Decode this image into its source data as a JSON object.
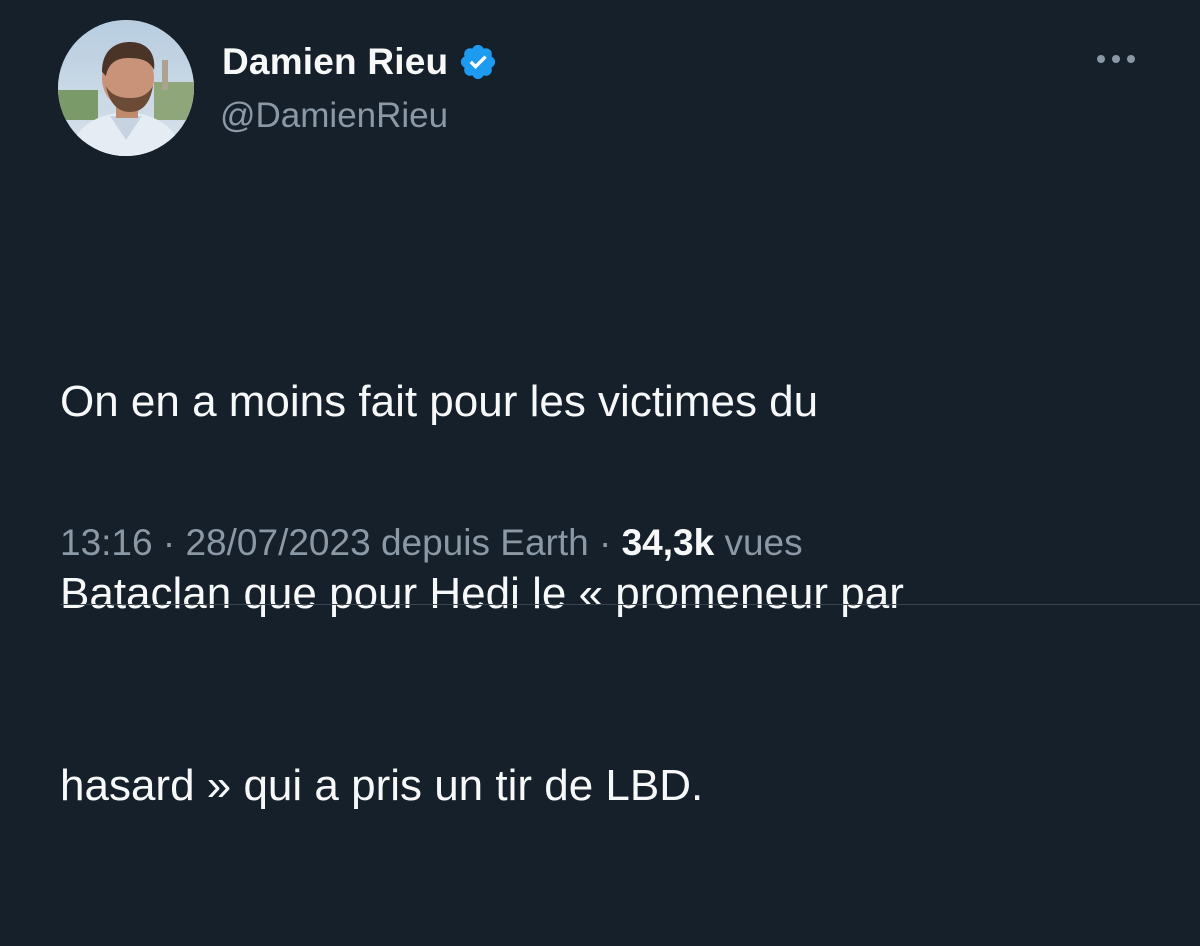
{
  "author": {
    "name": "Damien Rieu",
    "handle": "@DamienRieu",
    "verified": true,
    "verified_color": "#1d9bf0"
  },
  "tweet": {
    "lines": [
      "On en a moins fait pour les victimes du",
      "Bataclan que pour Hedi le « promeneur par",
      "hasard » qui a pris un tir de LBD."
    ]
  },
  "meta": {
    "time": "13:16",
    "separator1": " · ",
    "date": "28/07/2023",
    "source": " depuis Earth",
    "separator2": " · ",
    "views_count": "34,3k",
    "views_label": " vues"
  },
  "icons": {
    "more": "more-horizontal-icon",
    "verified": "verified-badge-icon"
  },
  "colors": {
    "background": "#15202b",
    "primary_text": "#f7f9f9",
    "secondary_text": "#8b98a5",
    "accent": "#1d9bf0"
  }
}
